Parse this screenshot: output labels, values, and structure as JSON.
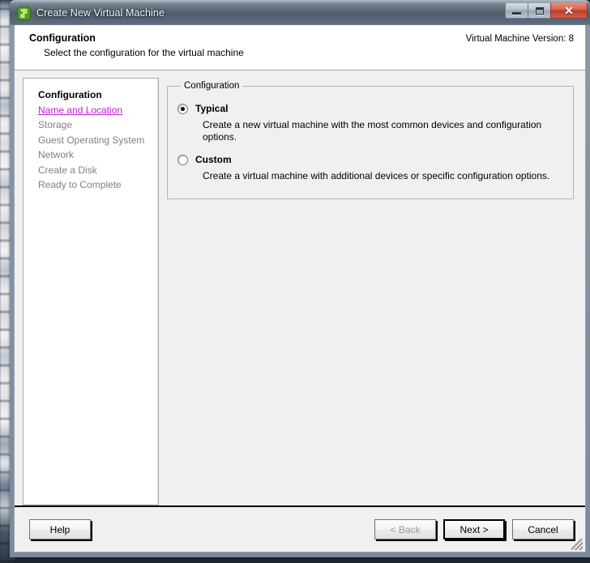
{
  "window": {
    "title": "Create New Virtual Machine",
    "icon": "vm-app-icon",
    "controls": {
      "minimize": "minimize-icon",
      "maximize": "maximize-icon",
      "close": "✕"
    }
  },
  "header": {
    "title": "Configuration",
    "subtitle": "Select the configuration for the virtual machine",
    "version": "Virtual Machine Version: 8"
  },
  "steps": [
    {
      "label": "Configuration",
      "state": "done"
    },
    {
      "label": "Name and Location",
      "state": "current"
    },
    {
      "label": "Storage",
      "state": "pending"
    },
    {
      "label": "Guest Operating System",
      "state": "pending"
    },
    {
      "label": "Network",
      "state": "pending"
    },
    {
      "label": "Create a Disk",
      "state": "pending"
    },
    {
      "label": "Ready to Complete",
      "state": "pending"
    }
  ],
  "group": {
    "legend": "Configuration",
    "options": [
      {
        "label": "Typical",
        "description": "Create a new virtual machine with the most common devices and configuration options.",
        "selected": true
      },
      {
        "label": "Custom",
        "description": "Create a virtual machine with additional devices or specific configuration options.",
        "selected": false
      }
    ]
  },
  "footer": {
    "help": "Help",
    "back": "< Back",
    "next": "Next >",
    "cancel": "Cancel"
  },
  "colors": {
    "titlebar": "#52626f",
    "close_button": "#c4452f",
    "current_step_link": "#bb22cc",
    "pending_step": "#808080",
    "client_background": "#f0f0f0",
    "panel_background": "#ffffff"
  }
}
